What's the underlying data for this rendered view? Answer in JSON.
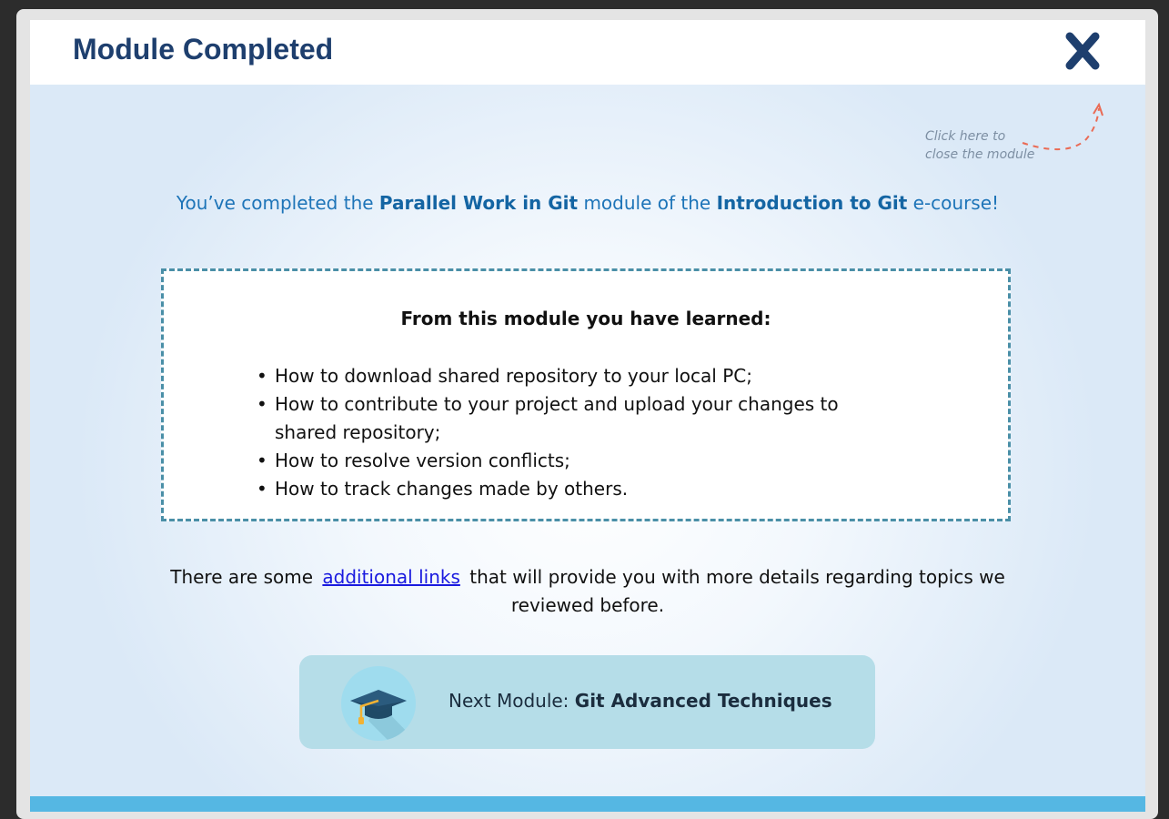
{
  "header": {
    "title": "Module Completed",
    "close_icon": "close-x-icon"
  },
  "hint": {
    "line1": "Click here to",
    "line2": "close the module"
  },
  "completion": {
    "prefix": "You’ve completed the ",
    "module_name": "Parallel Work in Git",
    "middle": " module of the ",
    "course_name": "Introduction to Git",
    "suffix": " e-course!"
  },
  "learned": {
    "title": "From this module you have learned:",
    "items": [
      "How to download shared repository to your local PC;",
      "How to contribute to your project and upload your changes to shared repository;",
      "How to resolve version conflicts;",
      "How to track changes made by others."
    ]
  },
  "more": {
    "prefix": "There are some",
    "link_text": "additional links",
    "suffix": "that will provide you with more details regarding topics we reviewed before."
  },
  "next_module": {
    "prefix": "Next Module: ",
    "name": "Git Advanced Techniques",
    "icon": "graduation-cap-icon"
  },
  "colors": {
    "title": "#1e3f6e",
    "accent_text": "#1d74b8",
    "box_border": "#4a8fa7",
    "link": "#1a1adf",
    "next_button_bg": "#b5dde8",
    "bottom_bar": "#55b7e3"
  }
}
